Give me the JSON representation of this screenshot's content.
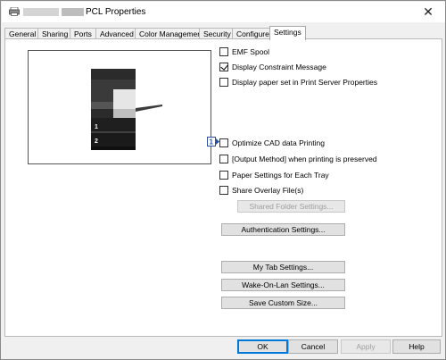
{
  "window": {
    "title": "PCL Properties",
    "close_icon": "close-icon"
  },
  "tabs": [
    {
      "label": "General"
    },
    {
      "label": "Sharing"
    },
    {
      "label": "Ports"
    },
    {
      "label": "Advanced"
    },
    {
      "label": "Color Management"
    },
    {
      "label": "Security"
    },
    {
      "label": "Configure"
    },
    {
      "label": "Settings",
      "active": true
    }
  ],
  "options": [
    {
      "label": "EMF Spool",
      "checked": false
    },
    {
      "label": "Display Constraint Message",
      "checked": true
    },
    {
      "label": "Display paper set in Print Server Properties",
      "checked": false
    },
    {
      "label": "Optimize CAD data Printing",
      "checked": false
    },
    {
      "label": "[Output Method] when printing is preserved",
      "checked": false
    },
    {
      "label": "Paper Settings for Each Tray",
      "checked": false
    },
    {
      "label": "Share Overlay File(s)",
      "checked": false
    }
  ],
  "buttons": {
    "shared_folder": "Shared Folder Settings...",
    "authentication": "Authentication Settings...",
    "my_tab": "My Tab Settings...",
    "wake_on_lan": "Wake-On-Lan Settings...",
    "save_custom": "Save Custom Size..."
  },
  "dialog_buttons": {
    "ok": "OK",
    "cancel": "Cancel",
    "apply": "Apply",
    "help": "Help"
  },
  "preview": {
    "tray_1": "1",
    "tray_2": "2"
  },
  "info_badge": "1",
  "colors": {
    "accent": "#0078d7",
    "info_badge": "#2b4fa8"
  }
}
